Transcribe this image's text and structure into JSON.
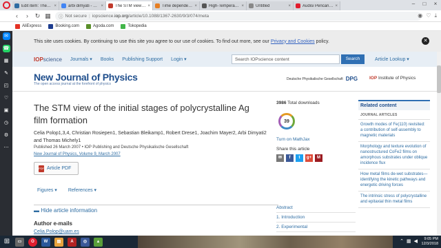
{
  "browser": {
    "tabs": [
      {
        "title": "Edit item: The STM",
        "color": "#2d6ca2",
        "active": false
      },
      {
        "title": "arbi dimyati - Goog",
        "color": "#4285f4",
        "active": false
      },
      {
        "title": "The STM view of th",
        "color": "#c0392b",
        "active": true
      },
      {
        "title": "Time dependence",
        "color": "#e67e22",
        "active": false
      },
      {
        "title": "High-Temperatur",
        "color": "#555555",
        "active": false
      },
      {
        "title": "Untitled",
        "color": "#888888",
        "active": false
      },
      {
        "title": "Audisi Pencarian V",
        "color": "#e11d2e",
        "active": false
      }
    ],
    "not_secure": "Not secure",
    "url_prefix": "iopscience.",
    "url_domain": "iop.org",
    "url_path": "/article/10.1088/1367-2630/9/3/074/meta",
    "bookmarks": [
      {
        "label": "AliExpress",
        "color": "#e43225"
      },
      {
        "label": "Booking.com",
        "color": "#1e3d8f"
      },
      {
        "label": "Agoda.com",
        "color": "#5a8f2a"
      },
      {
        "label": "Tokopedia",
        "color": "#42b549"
      }
    ]
  },
  "cookie": {
    "text": "This site uses cookies. By continuing to use this site you agree to our use of cookies. To find out more, see our ",
    "link": "Privacy and Cookies",
    "suffix": " policy."
  },
  "nav": {
    "logo_main": "IOP",
    "logo_sub": "science",
    "links": [
      "Journals ▾",
      "Books",
      "Publishing Support",
      "Login ▾"
    ],
    "search_placeholder": "Search IOPscience content",
    "search_btn": "Search",
    "article_lookup": "Article Lookup ▾"
  },
  "journal": {
    "name": "New Journal of Physics",
    "tagline": "The open access journal at the forefront of physics",
    "dpg_text": "Deutsche Physikalische Gesellschaft",
    "dpg_abbr": "DPG",
    "iop_text": "Institute of Physics",
    "iop_abbr": "IOP"
  },
  "article": {
    "title": "The STM view of the initial stages of polycrystalline Ag film formation",
    "authors": "Celia Polop1,3,4, Christian Rosiepen1, Sebastian Bleikamp1, Robert Drese1, Joachim Mayer2, Arbi Dimyati2 and Thomas Michely1",
    "pubinfo": "Published 26 March 2007 • IOP Publishing and Deutsche Physikalische Gesellschaft",
    "citation": "New Journal of Physics, Volume 9, March 2007",
    "pdf_label": "Article PDF",
    "figures": "Figures ▾",
    "references": "References ▾",
    "hide_info": "▬ Hide article information",
    "emails_heading": "Author e-mails",
    "email": "Celia.Polop@uam.es"
  },
  "metrics": {
    "downloads_num": "3986",
    "downloads_label": "Total downloads",
    "badge": "39",
    "mathjax": "Turn on MathJax",
    "share": "Share this article",
    "share_icons": [
      {
        "name": "email-icon",
        "glyph": "✉",
        "color": "#777777"
      },
      {
        "name": "facebook-icon",
        "glyph": "f",
        "color": "#3b5998"
      },
      {
        "name": "twitter-icon",
        "glyph": "t",
        "color": "#1da1f2"
      },
      {
        "name": "googleplus-icon",
        "glyph": "g+",
        "color": "#dd4b39"
      },
      {
        "name": "mendeley-icon",
        "glyph": "M",
        "color": "#9b1b21"
      }
    ]
  },
  "toc": [
    "Abstract",
    "1. Introduction",
    "2. Experimental"
  ],
  "related": {
    "heading": "Related content",
    "sub": "JOURNAL ARTICLES",
    "items": [
      "Growth modes of Fe(110) revisited: a contribution of self-assembly to magnetic materials",
      "Morphology and texture evolution of nanostructured CoFe2 films on amorphous substrates under oblique incidence flux",
      "How metal films de-wet substrates—identifying the kinetic pathways and energetic driving forces",
      "The intrinsic stress of polycrystalline and epitaxial thin metal films"
    ]
  },
  "taskbar": {
    "time": "9:05 PM",
    "date": "12/3/2018"
  }
}
